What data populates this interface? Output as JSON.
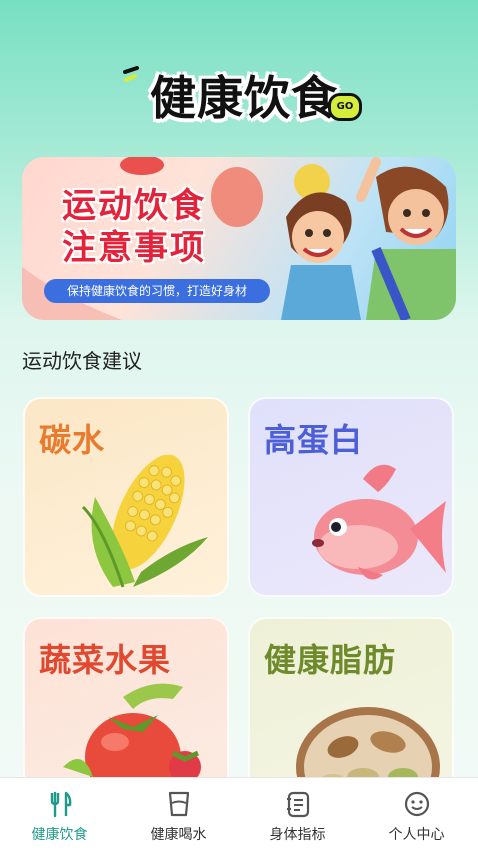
{
  "header": {
    "title": "健康饮食",
    "badge": "GO"
  },
  "banner": {
    "title_line1": "运动饮食",
    "title_line2": "注意事项",
    "subtitle": "保持健康饮食的习惯，打造好身材"
  },
  "section": {
    "title": "运动饮食建议"
  },
  "cards": [
    {
      "label": "碳水",
      "color": "#e97b2f",
      "icon": "corn-icon"
    },
    {
      "label": "高蛋白",
      "color": "#4c5fd8",
      "icon": "fish-icon"
    },
    {
      "label": "蔬菜水果",
      "color": "#e0492f",
      "icon": "tomato-icon"
    },
    {
      "label": "健康脂肪",
      "color": "#6f8a2a",
      "icon": "nuts-icon"
    }
  ],
  "tabbar": {
    "items": [
      {
        "label": "健康饮食",
        "icon": "fork-knife-icon",
        "active": true
      },
      {
        "label": "健康喝水",
        "icon": "cup-icon",
        "active": false
      },
      {
        "label": "身体指标",
        "icon": "notebook-icon",
        "active": false
      },
      {
        "label": "个人中心",
        "icon": "face-icon",
        "active": false
      }
    ],
    "active_color": "#1f9a88"
  }
}
